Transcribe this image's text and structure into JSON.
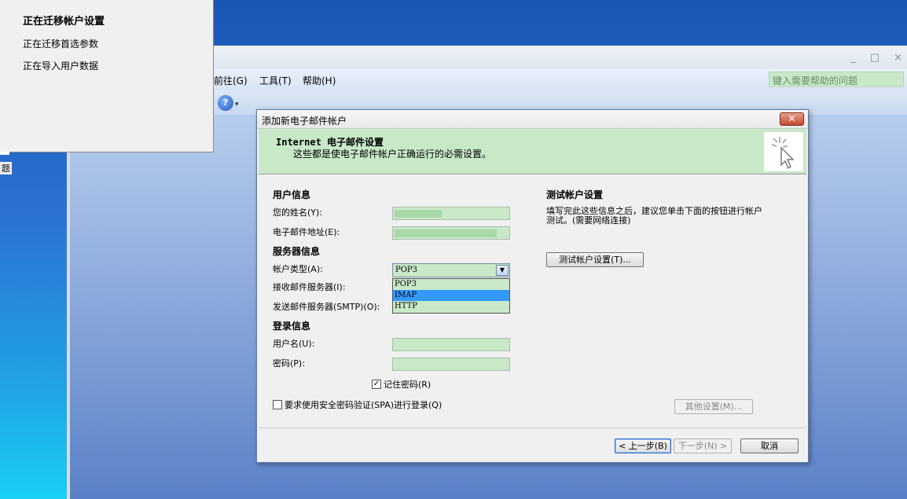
{
  "outlook": {
    "menu": [
      "前往(G)",
      "工具(T)",
      "帮助(H)"
    ],
    "help_search_placeholder": "键入需要帮助的问题",
    "window_controls": [
      "_",
      "□",
      "×"
    ]
  },
  "migration": {
    "title": "正在迁移帐户设置",
    "steps": [
      "正在迁移首选参数",
      "正在导入用户数据"
    ],
    "side_fragment": "题"
  },
  "dialog": {
    "title": "添加新电子邮件帐户",
    "close_glyph": "✕",
    "banner_title": "Internet 电子邮件设置",
    "banner_subtitle": "这些都是使电子邮件帐户正确运行的必需设置。",
    "user_info": {
      "heading": "用户信息",
      "name_label": "您的姓名(Y):",
      "email_label": "电子邮件地址(E):"
    },
    "server_info": {
      "heading": "服务器信息",
      "account_type_label": "帐户类型(A):",
      "account_type_value": "POP3",
      "account_type_options": [
        "POP3",
        "IMAP",
        "HTTP"
      ],
      "account_type_highlighted": "IMAP",
      "incoming_label": "接收邮件服务器(I):",
      "outgoing_label": "发送邮件服务器(SMTP)(O):"
    },
    "login_info": {
      "heading": "登录信息",
      "username_label": "用户名(U):",
      "password_label": "密码(P):",
      "remember_label": "记住密码(R)",
      "remember_checked": true,
      "spa_label": "要求使用安全密码验证(SPA)进行登录(Q)",
      "spa_checked": false
    },
    "test": {
      "heading": "测试帐户设置",
      "description": "填写完此这些信息之后，建议您单击下面的按钮进行帐户测试。(需要网络连接)",
      "button": "测试帐户设置(T)..."
    },
    "more_settings": "其他设置(M)...",
    "buttons": {
      "back": "< 上一步(B)",
      "next": "下一步(N) >",
      "cancel": "取消"
    }
  }
}
